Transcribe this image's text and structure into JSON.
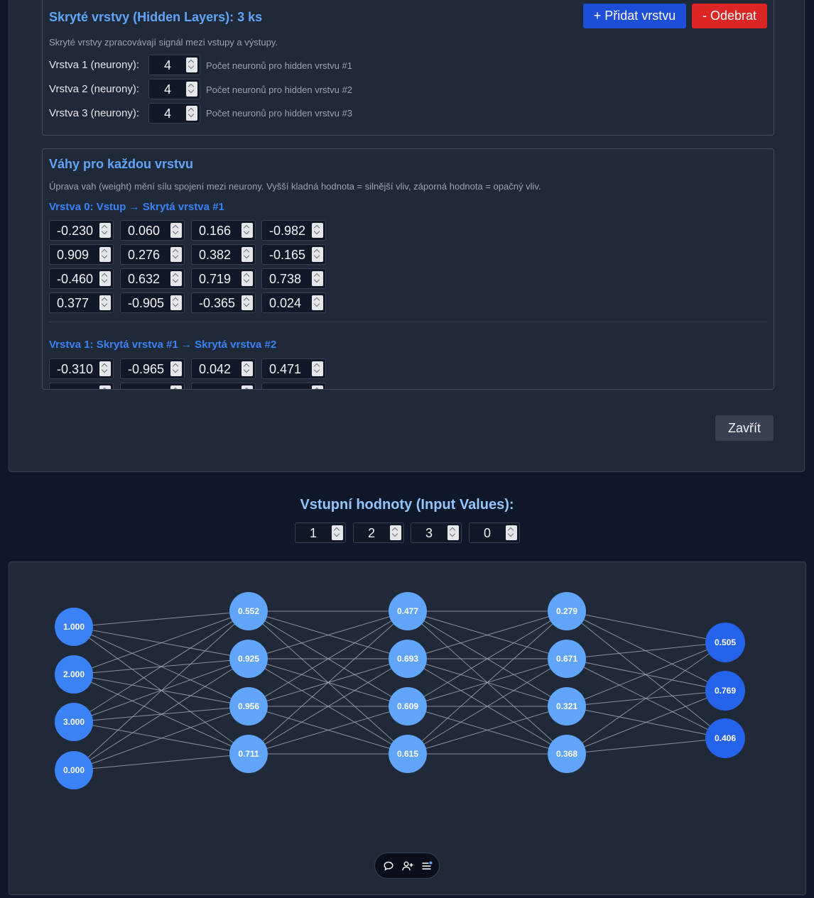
{
  "hidden_layers": {
    "title": "Skryté vrstvy (Hidden Layers): 3 ks",
    "description": "Skryté vrstvy zpracovávají signál mezi vstupy a výstupy.",
    "add_button": "+ Přidat vrstvu",
    "remove_button": "- Odebrat",
    "rows": [
      {
        "label": "Vrstva 1 (neurony):",
        "value": "4",
        "hint": "Počet neuronů pro hidden vrstvu #1"
      },
      {
        "label": "Vrstva 2 (neurony):",
        "value": "4",
        "hint": "Počet neuronů pro hidden vrstvu #2"
      },
      {
        "label": "Vrstva 3 (neurony):",
        "value": "4",
        "hint": "Počet neuronů pro hidden vrstvu #3"
      }
    ]
  },
  "weights": {
    "title": "Váhy pro každou vrstvu",
    "description": "Úprava vah (weight) mění sílu spojení mezi neurony. Vyšší kladná hodnota = silnější vliv, záporná hodnota = opačný vliv.",
    "layers": [
      {
        "heading": "Vrstva 0: Vstup → Skrytá vrstva #1",
        "matrix": [
          [
            "-0.230",
            "0.060",
            "0.166",
            "-0.982"
          ],
          [
            "0.909",
            "0.276",
            "0.382",
            "-0.165"
          ],
          [
            "-0.460",
            "0.632",
            "0.719",
            "0.738"
          ],
          [
            "0.377",
            "-0.905",
            "-0.365",
            "0.024"
          ]
        ]
      },
      {
        "heading": "Vrstva 1: Skrytá vrstva #1 → Skrytá vrstva #2",
        "matrix": [
          [
            "-0.310",
            "-0.965",
            "0.042",
            "0.471"
          ]
        ]
      }
    ]
  },
  "close_button": "Zavřít",
  "inputs": {
    "title": "Vstupní hodnoty (Input Values):",
    "values": [
      "1",
      "2",
      "3",
      "0"
    ]
  },
  "network": {
    "input_color": "#3b82f6",
    "hidden_color": "#60a5fa",
    "output_color": "#2563eb",
    "edge_color": "#9ca3af",
    "layers": [
      {
        "kind": "input",
        "values": [
          "1.000",
          "2.000",
          "3.000",
          "0.000"
        ]
      },
      {
        "kind": "hidden",
        "values": [
          "0.552",
          "0.925",
          "0.956",
          "0.711"
        ]
      },
      {
        "kind": "hidden",
        "values": [
          "0.477",
          "0.693",
          "0.609",
          "0.615"
        ]
      },
      {
        "kind": "hidden",
        "values": [
          "0.279",
          "0.671",
          "0.321",
          "0.368"
        ]
      },
      {
        "kind": "output",
        "values": [
          "0.505",
          "0.769",
          "0.406"
        ]
      }
    ]
  },
  "fab": {
    "icons": [
      "chat-bubble-icon",
      "add-user-icon",
      "list-menu-icon"
    ]
  }
}
